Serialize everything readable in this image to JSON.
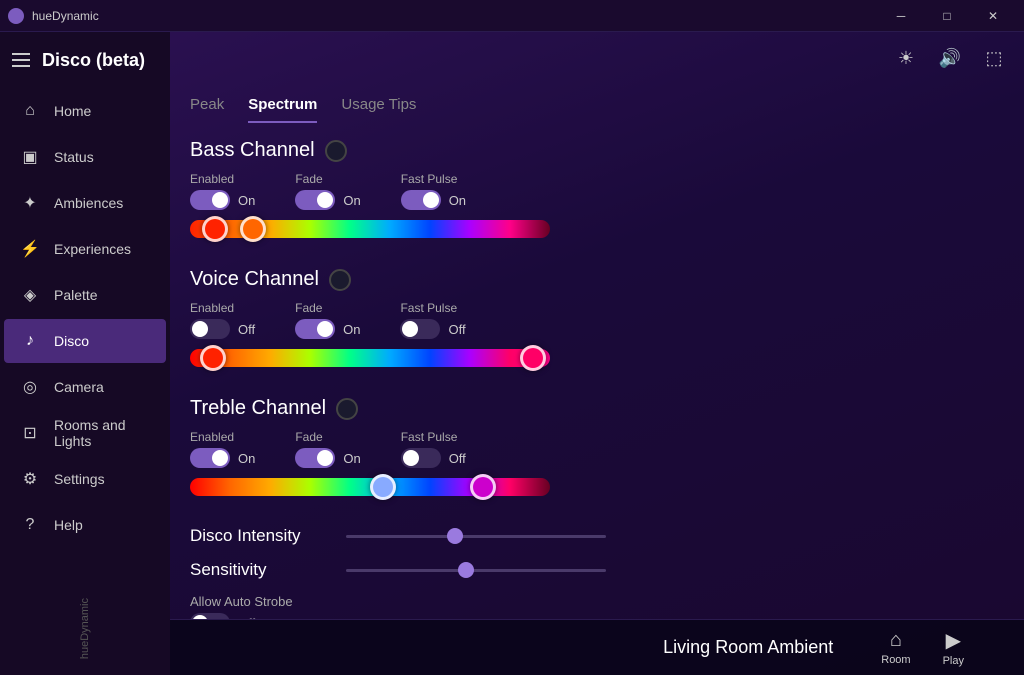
{
  "titlebar": {
    "icon": "●",
    "title": "hueDynamic",
    "minimize": "─",
    "maximize": "□",
    "close": "✕"
  },
  "sidebar": {
    "appTitle": "Disco (beta)",
    "brand": "hueDynamic",
    "navItems": [
      {
        "id": "home",
        "label": "Home",
        "icon": "⌂"
      },
      {
        "id": "status",
        "label": "Status",
        "icon": "▣"
      },
      {
        "id": "ambiences",
        "label": "Ambiences",
        "icon": "✦"
      },
      {
        "id": "experiences",
        "label": "Experiences",
        "icon": "⚡"
      },
      {
        "id": "palette",
        "label": "Palette",
        "icon": "◈"
      },
      {
        "id": "disco",
        "label": "Disco",
        "icon": "♪",
        "active": true
      },
      {
        "id": "camera",
        "label": "Camera",
        "icon": "◎"
      },
      {
        "id": "rooms",
        "label": "Rooms and Lights",
        "icon": "⊡"
      },
      {
        "id": "settings",
        "label": "Settings",
        "icon": "⚙"
      },
      {
        "id": "help",
        "label": "Help",
        "icon": "?"
      }
    ]
  },
  "tabs": [
    {
      "id": "peak",
      "label": "Peak"
    },
    {
      "id": "spectrum",
      "label": "Spectrum",
      "active": true
    },
    {
      "id": "tips",
      "label": "Usage Tips"
    }
  ],
  "channels": [
    {
      "id": "bass",
      "title": "Bass Channel",
      "enabled": {
        "label": "Enabled",
        "state": "on",
        "value": "On"
      },
      "fade": {
        "label": "Fade",
        "state": "on",
        "value": "On"
      },
      "fastPulse": {
        "label": "Fast Pulse",
        "state": "on",
        "value": "On"
      },
      "sliderGradient": "linear-gradient(to right, #ff2200, #ff6600, #ffaa00, #aaff00, #00ff88, #00aaff, #0044ff, #aa00ff, #ff0088, #660022)",
      "thumb1Left": "12px",
      "thumb1Color": "#ff2200",
      "thumb2Left": "50px",
      "thumb2Color": "#ff6600"
    },
    {
      "id": "voice",
      "title": "Voice Channel",
      "enabled": {
        "label": "Enabled",
        "state": "off",
        "value": "Off"
      },
      "fade": {
        "label": "Fade",
        "state": "on",
        "value": "On"
      },
      "fastPulse": {
        "label": "Fast Pulse",
        "state": "off",
        "value": "Off"
      },
      "sliderGradient": "linear-gradient(to right, #ff0000, #ff6600, #ffaa00, #aaff00, #00ff88, #00aaff, #0044ff, #aa00ff, #ff0066, #ff0088)",
      "thumb1Left": "10px",
      "thumb1Color": "#ff2200",
      "thumb2Left": "330px",
      "thumb2Color": "#ff0066"
    },
    {
      "id": "treble",
      "title": "Treble Channel",
      "enabled": {
        "label": "Enabled",
        "state": "on",
        "value": "On"
      },
      "fade": {
        "label": "Fade",
        "state": "on",
        "value": "On"
      },
      "fastPulse": {
        "label": "Fast Pulse",
        "state": "off",
        "value": "Off"
      },
      "sliderGradient": "linear-gradient(to right, #ff0000, #ff6600, #ffaa00, #aaff00, #00ff88, #00aaff, #0044ff, #aa00ff, #ff0066, #660022)",
      "thumb1Left": "180px",
      "thumb1Color": "#88aaff",
      "thumb2Left": "280px",
      "thumb2Color": "#cc00cc"
    }
  ],
  "discoIntensity": {
    "label": "Disco Intensity",
    "thumbLeft": "42%"
  },
  "sensitivity": {
    "label": "Sensitivity",
    "thumbLeft": "46%"
  },
  "autoStrobe": {
    "label": "Allow Auto Strobe",
    "state": "off",
    "value": "Off"
  },
  "bottomBar": {
    "sceneName": "Living Room Ambient",
    "roomLabel": "Room",
    "playLabel": "Play"
  },
  "headerIcons": {
    "brightness": "☀",
    "sound": "🔊",
    "screen": "⬚"
  }
}
